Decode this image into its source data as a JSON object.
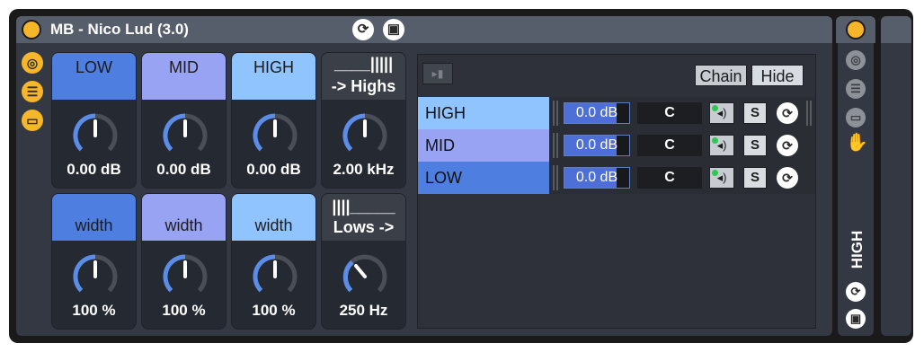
{
  "device": {
    "title": "MB - Nico Lud (3.0)",
    "colors": {
      "low": "#4e7fe0",
      "mid": "#99a3f3",
      "high": "#8fc4ff",
      "accent": "#f5b62a"
    }
  },
  "knobs": {
    "low": {
      "label": "LOW",
      "value": "0.00 dB",
      "level": 0.5
    },
    "mid": {
      "label": "MID",
      "value": "0.00 dB",
      "level": 0.5
    },
    "high": {
      "label": "HIGH",
      "value": "0.00 dB",
      "level": 0.5
    },
    "crossover_high": {
      "graphic": "____||||| ",
      "label": "-> Highs",
      "value": "2.00 kHz",
      "level": 0.5
    },
    "low_width": {
      "label": "width",
      "value": "100 %",
      "level": 0.5
    },
    "mid_width": {
      "label": "width",
      "value": "100 %",
      "level": 0.5
    },
    "high_width": {
      "label": "width",
      "value": "100 %",
      "level": 0.5
    },
    "crossover_low": {
      "graphic": "||||_____",
      "label": "Lows ->",
      "value": "250 Hz",
      "level": 0.35
    }
  },
  "chain": {
    "chain_label": "Chain",
    "hide_label": "Hide",
    "rows": [
      {
        "name": "HIGH",
        "volume": "0.0 dB",
        "pan": "C",
        "solo": "S"
      },
      {
        "name": "MID",
        "volume": "0.0 dB",
        "pan": "C",
        "solo": "S"
      },
      {
        "name": "LOW",
        "volume": "0.0 dB",
        "pan": "C",
        "solo": "S"
      }
    ]
  },
  "side": {
    "label": "HIGH"
  }
}
